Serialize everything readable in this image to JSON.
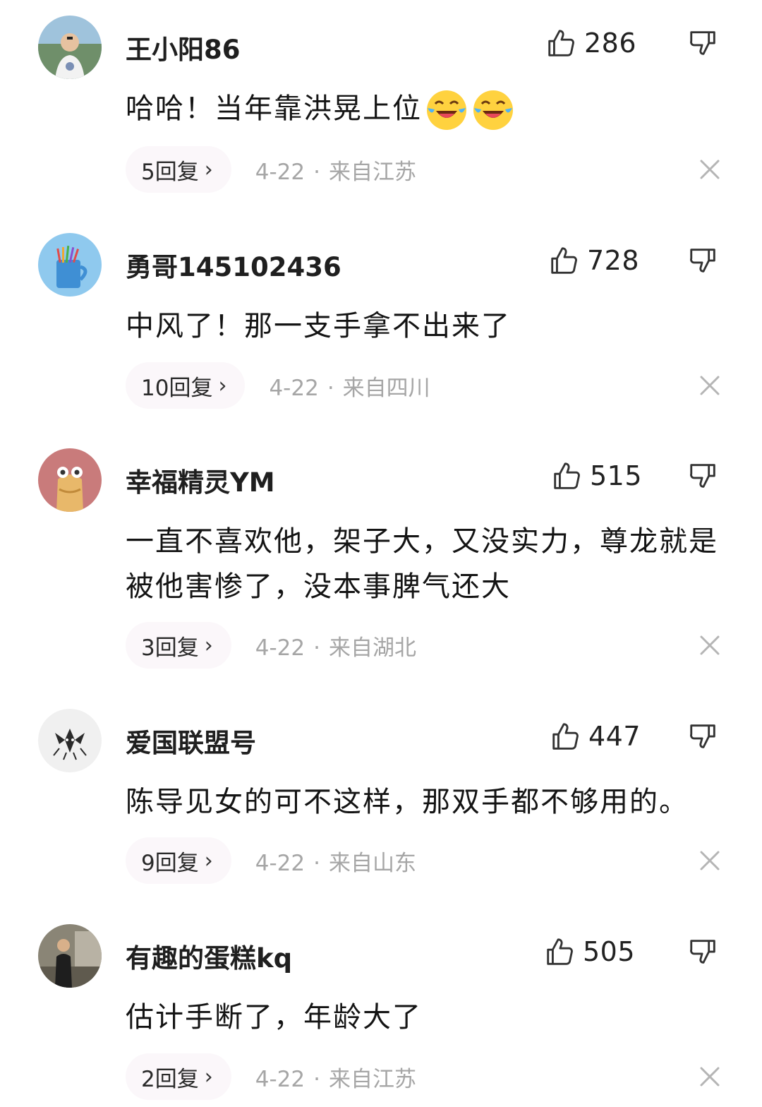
{
  "comments": [
    {
      "username": "王小阳86",
      "likes": "286",
      "text": "哈哈！当年靠洪晃上位",
      "emojis": [
        "laughing-crying-emoji",
        "laughing-crying-emoji"
      ],
      "replies": "5回复",
      "date": "4-22",
      "location": "来自江苏"
    },
    {
      "username": "勇哥145102436",
      "likes": "728",
      "text": "中风了！那一支手拿不出来了",
      "replies": "10回复",
      "date": "4-22",
      "location": "来自四川"
    },
    {
      "username": "幸福精灵YM",
      "likes": "515",
      "text": "一直不喜欢他，架子大，又没实力，尊龙就是被他害惨了，没本事脾气还大",
      "replies": "3回复",
      "date": "4-22",
      "location": "来自湖北"
    },
    {
      "username": "爱国联盟号",
      "likes": "447",
      "text": "陈导见女的可不这样，那双手都不够用的。",
      "replies": "9回复",
      "date": "4-22",
      "location": "来自山东"
    },
    {
      "username": "有趣的蛋糕kq",
      "likes": "505",
      "text": "估计手断了，年龄大了",
      "replies": "2回复",
      "date": "4-22",
      "location": "来自江苏"
    }
  ],
  "icons": {
    "like": "thumbs-up-icon",
    "dislike": "thumbs-down-icon",
    "reply_chevron": "chevron-right-icon",
    "close": "close-icon"
  },
  "meta_separator": "·",
  "reply_chevron_glyph": "›",
  "colors": {
    "reply_pill_bg": "#fbf7fa",
    "meta_text": "#a6a6a6"
  }
}
